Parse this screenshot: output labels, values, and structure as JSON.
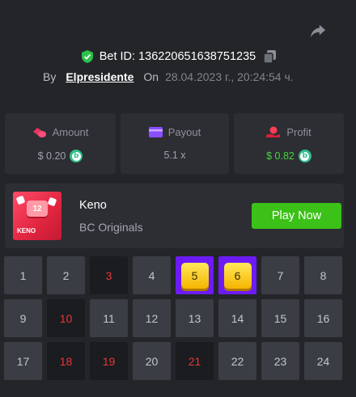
{
  "header": {
    "bet_id": "Bet ID: 136220651638751235",
    "by_label": "By",
    "username": "Elpresidente",
    "on_label": "On",
    "date": "28.04.2023 г., 20:24:54 ч."
  },
  "stats": {
    "amount_label": "Amount",
    "amount_value": "$ 0.20",
    "payout_label": "Payout",
    "payout_value": "5.1 x",
    "profit_label": "Profit",
    "profit_value": "$ 0.82",
    "coin_letter": "b"
  },
  "game": {
    "thumb_number": "12",
    "thumb_name": "KENO",
    "title": "Keno",
    "provider": "BC Originals",
    "play_label": "Play Now"
  },
  "board": {
    "numbers": [
      "1",
      "2",
      "3",
      "4",
      "5",
      "6",
      "7",
      "8",
      "9",
      "10",
      "11",
      "12",
      "13",
      "14",
      "15",
      "16",
      "17",
      "18",
      "19",
      "20",
      "21",
      "22",
      "23",
      "24"
    ],
    "picked_misses": [
      3,
      10,
      18,
      19,
      21
    ],
    "hits": [
      5,
      6
    ]
  },
  "colors": {
    "background": "#232529",
    "card": "#2c2e33",
    "cell": "#3a3d44",
    "picked": "#1b1c1f",
    "miss_text": "#e8353a",
    "hit_bg": "#6c1bf5",
    "play_green": "#3bc117",
    "profit_green": "#43d63b"
  },
  "icons": {
    "share": "share-arrow-icon",
    "shield": "verified-shield-icon",
    "copy": "copy-icon",
    "amount": "coins-icon",
    "payout": "wallet-card-icon",
    "profit": "profit-hand-icon"
  }
}
